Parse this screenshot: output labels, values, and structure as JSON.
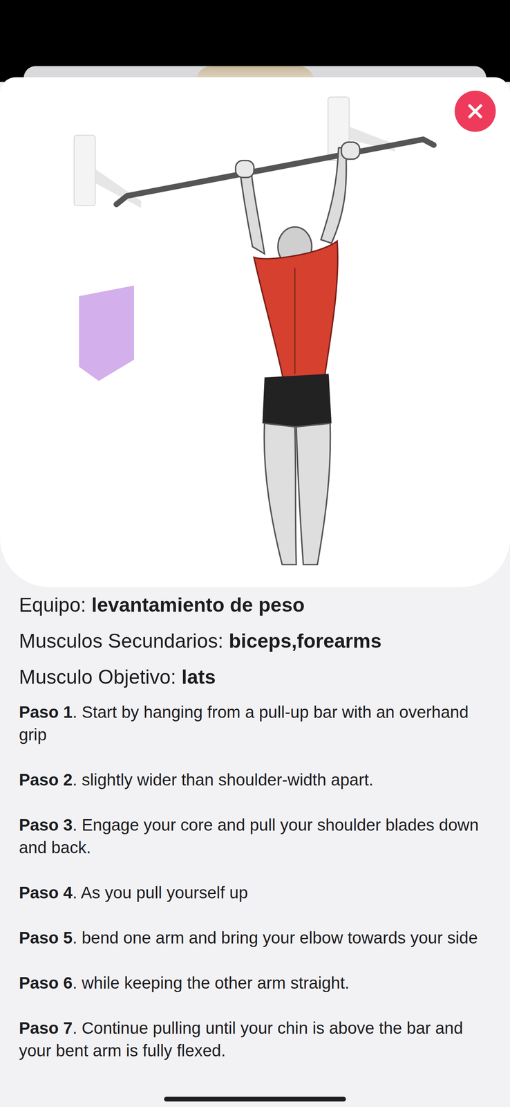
{
  "details": [
    {
      "label": "Equipo: ",
      "value": "levantamiento de peso"
    },
    {
      "label": "Musculos Secundarios: ",
      "value": "biceps,forearms"
    },
    {
      "label": "Musculo Objetivo: ",
      "value": "lats"
    }
  ],
  "steps": [
    {
      "label": "Paso 1",
      "text": ". Start by hanging from a pull-up bar with an overhand grip"
    },
    {
      "label": "Paso 2",
      "text": ". slightly wider than shoulder-width apart."
    },
    {
      "label": "Paso 3",
      "text": ". Engage your core and pull your shoulder blades down and back."
    },
    {
      "label": "Paso 4",
      "text": ". As you pull yourself up"
    },
    {
      "label": "Paso 5",
      "text": ". bend one arm and bring your elbow towards your side"
    },
    {
      "label": "Paso 6",
      "text": ". while keeping the other arm straight."
    },
    {
      "label": "Paso 7",
      "text": ". Continue pulling until your chin is above the bar and your bent arm is fully flexed."
    }
  ]
}
